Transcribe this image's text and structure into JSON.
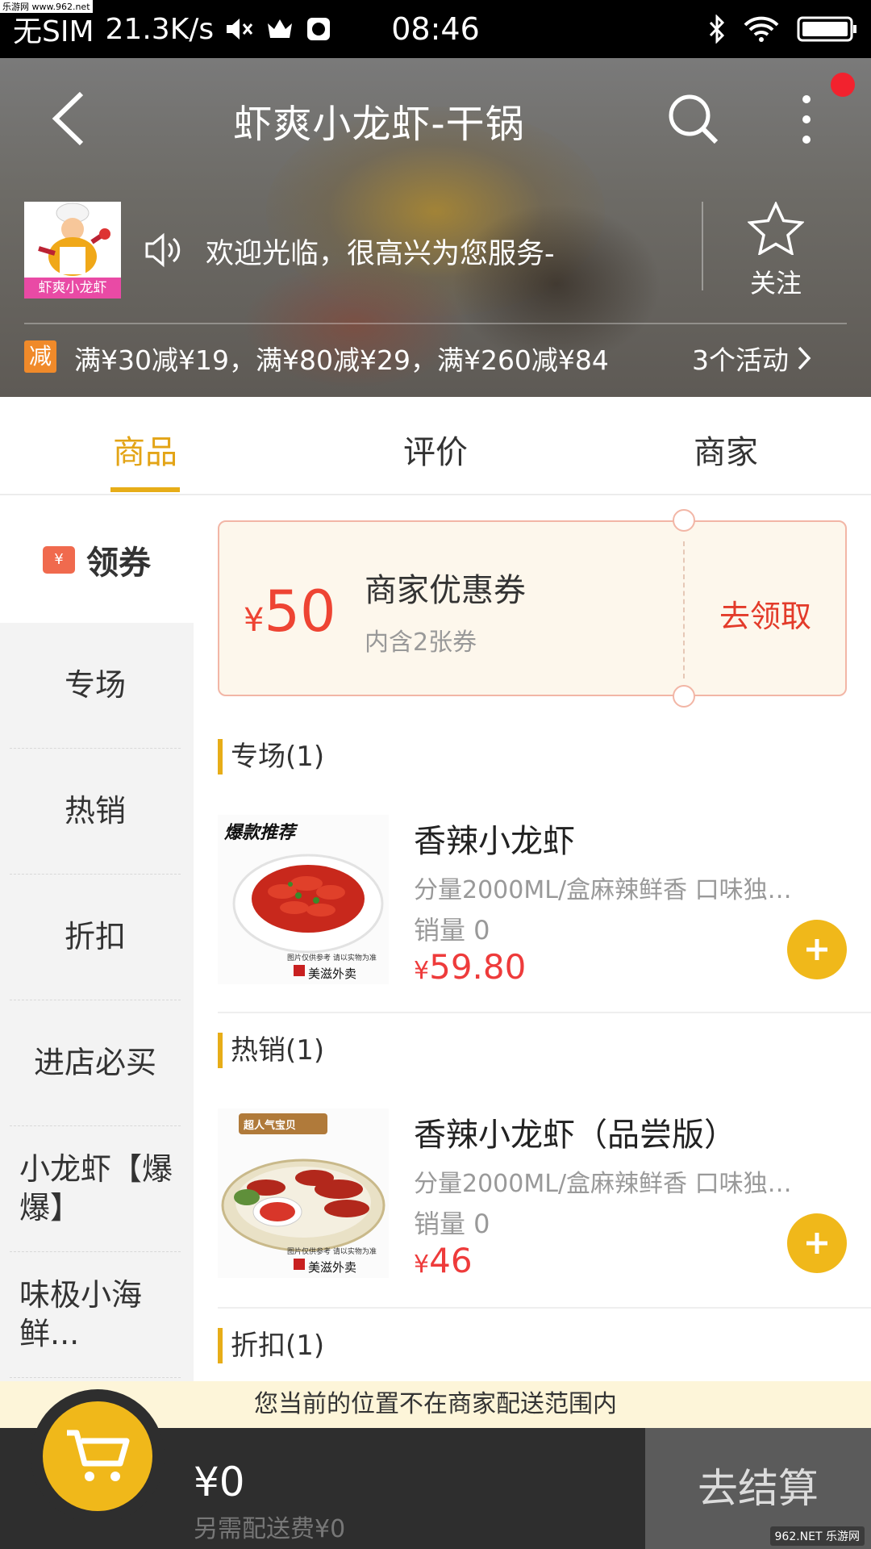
{
  "watermark": "乐游网 www.962.net",
  "status": {
    "carrier": "无SIM",
    "speed": "21.3K/s",
    "time": "08:46"
  },
  "header": {
    "title": "虾爽小龙虾-干锅",
    "logo_caption": "虾爽小龙虾",
    "notice": "欢迎光临，很高兴为您服务-",
    "follow_label": "关注",
    "promo_badge": "减",
    "promo_text": "满¥30减¥19，满¥80减¥29，满¥260减¥84",
    "promo_more": "3个活动"
  },
  "tabs": [
    {
      "label": "商品",
      "active": true
    },
    {
      "label": "评价",
      "active": false
    },
    {
      "label": "商家",
      "active": false
    }
  ],
  "sidebar": {
    "coupon_label": "领券",
    "items": [
      "专场",
      "热销",
      "折扣",
      "进店必买",
      "小龙虾【爆爆】",
      "味极小海鲜..."
    ]
  },
  "coupon": {
    "currency": "¥",
    "amount": "50",
    "title": "商家优惠券",
    "subtitle": "内含2张券",
    "claim": "去领取"
  },
  "sections": [
    {
      "title": "专场(1)"
    },
    {
      "title": "热销(1)"
    },
    {
      "title": "折扣(1)"
    }
  ],
  "products": [
    {
      "name": "香辣小龙虾",
      "desc": "分量2000ML/盒麻辣鲜香 口味独…",
      "sales": "销量 0",
      "currency": "¥",
      "price": "59.80",
      "img_text_top": "爆款推荐",
      "img_text_note": "图片仅供参考 请以实物为准",
      "img_text_brand": "美滋外卖"
    },
    {
      "name": "香辣小龙虾（品尝版）",
      "desc": "分量2000ML/盒麻辣鲜香 口味独…",
      "sales": "销量 0",
      "currency": "¥",
      "price": "46",
      "img_text_top": "超人气宝贝",
      "img_text_note": "图片仅供参考 请以实物为准",
      "img_text_brand": "美滋外卖"
    }
  ],
  "bottom": {
    "notice": "您当前的位置不在商家配送范围内",
    "total": "¥0",
    "delivery_fee": "另需配送费¥0",
    "checkout": "去结算",
    "site_badge": "962.NET 乐游网"
  },
  "colors": {
    "accent": "#e7ad18",
    "price_red": "#ee3b3b",
    "coupon_red": "#e33b2a"
  }
}
